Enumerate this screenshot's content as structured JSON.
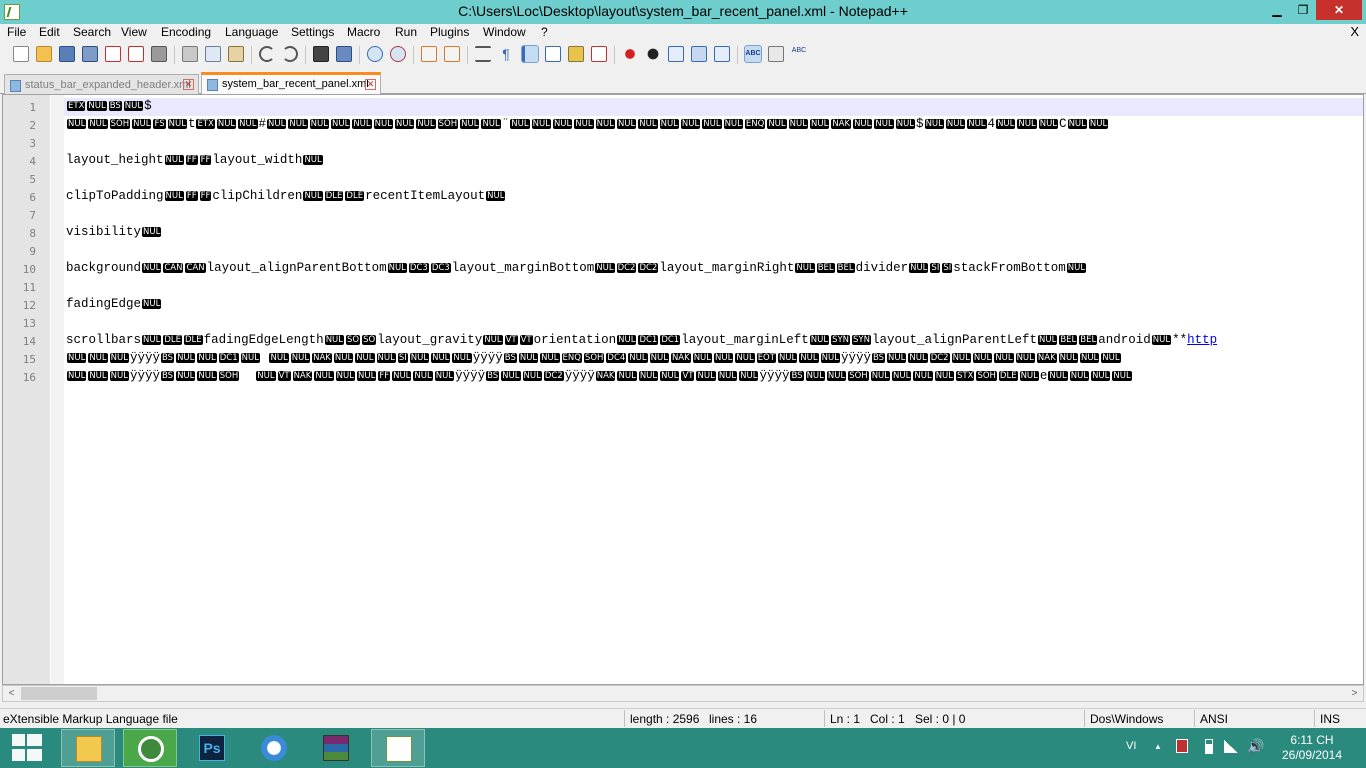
{
  "window": {
    "title": "C:\\Users\\Loc\\Desktop\\layout\\system_bar_recent_panel.xml - Notepad++",
    "min": "▁",
    "max": "❐",
    "close": "✕"
  },
  "menu": {
    "items": [
      "File",
      "Edit",
      "Search",
      "View",
      "Encoding",
      "Language",
      "Settings",
      "Macro",
      "Run",
      "Plugins",
      "Window",
      "?"
    ],
    "close": "X"
  },
  "tabs": [
    {
      "label": "status_bar_expanded_header.xml",
      "close": "✕"
    },
    {
      "label": "system_bar_recent_panel.xml",
      "close": "✕"
    }
  ],
  "editor": {
    "line_numbers": [
      "1",
      "2",
      "3",
      "4",
      "5",
      "6",
      "7",
      "8",
      "9",
      "10",
      "11",
      "12",
      "13",
      "14",
      "15",
      "16"
    ],
    "lines": [
      [
        [
          "c",
          "ETX"
        ],
        [
          "c",
          "NUL"
        ],
        [
          "c",
          "BS"
        ],
        [
          "c",
          "NUL"
        ],
        [
          "t",
          "$"
        ]
      ],
      [
        [
          "c",
          "NUL"
        ],
        [
          "c",
          "NUL"
        ],
        [
          "c",
          "SOH"
        ],
        [
          "c",
          "NUL"
        ],
        [
          "c",
          "FS"
        ],
        [
          "c",
          "NUL"
        ],
        [
          "t",
          "t"
        ],
        [
          "c",
          "ETX"
        ],
        [
          "c",
          "NUL"
        ],
        [
          "c",
          "NUL"
        ],
        [
          "t",
          "#"
        ],
        [
          "c",
          "NUL"
        ],
        [
          "c",
          "NUL"
        ],
        [
          "c",
          "NUL"
        ],
        [
          "c",
          "NUL"
        ],
        [
          "c",
          "NUL"
        ],
        [
          "c",
          "NUL"
        ],
        [
          "c",
          "NUL"
        ],
        [
          "c",
          "NUL"
        ],
        [
          "c",
          "SOH"
        ],
        [
          "c",
          "NUL"
        ],
        [
          "c",
          "NUL"
        ],
        [
          "t",
          "¨"
        ],
        [
          "c",
          "NUL"
        ],
        [
          "c",
          "NUL"
        ],
        [
          "c",
          "NUL"
        ],
        [
          "c",
          "NUL"
        ],
        [
          "c",
          "NUL"
        ],
        [
          "c",
          "NUL"
        ],
        [
          "c",
          "NUL"
        ],
        [
          "c",
          "NUL"
        ],
        [
          "c",
          "NUL"
        ],
        [
          "c",
          "NUL"
        ],
        [
          "c",
          "NUL"
        ],
        [
          "c",
          "ENQ"
        ],
        [
          "c",
          "NUL"
        ],
        [
          "c",
          "NUL"
        ],
        [
          "c",
          "NUL"
        ],
        [
          "c",
          "NAK"
        ],
        [
          "c",
          "NUL"
        ],
        [
          "c",
          "NUL"
        ],
        [
          "c",
          "NUL"
        ],
        [
          "t",
          "$"
        ],
        [
          "c",
          "NUL"
        ],
        [
          "c",
          "NUL"
        ],
        [
          "c",
          "NUL"
        ],
        [
          "t",
          "4"
        ],
        [
          "c",
          "NUL"
        ],
        [
          "c",
          "NUL"
        ],
        [
          "c",
          "NUL"
        ],
        [
          "t",
          "C"
        ],
        [
          "c",
          "NUL"
        ],
        [
          "c",
          "NUL"
        ]
      ],
      [],
      [
        [
          "t",
          "layout_height"
        ],
        [
          "c",
          "NUL"
        ],
        [
          "c",
          "FF"
        ],
        [
          "c",
          "FF"
        ],
        [
          "t",
          "layout_width"
        ],
        [
          "c",
          "NUL"
        ]
      ],
      [],
      [
        [
          "t",
          "clipToPadding"
        ],
        [
          "c",
          "NUL"
        ],
        [
          "c",
          "FF"
        ],
        [
          "c",
          "FF"
        ],
        [
          "t",
          "clipChildren"
        ],
        [
          "c",
          "NUL"
        ],
        [
          "c",
          "DLE"
        ],
        [
          "c",
          "DLE"
        ],
        [
          "t",
          "recentItemLayout"
        ],
        [
          "c",
          "NUL"
        ]
      ],
      [],
      [
        [
          "t",
          "visibility"
        ],
        [
          "c",
          "NUL"
        ]
      ],
      [],
      [
        [
          "t",
          "background"
        ],
        [
          "c",
          "NUL"
        ],
        [
          "c",
          "CAN"
        ],
        [
          "c",
          "CAN"
        ],
        [
          "t",
          "layout_alignParentBottom"
        ],
        [
          "c",
          "NUL"
        ],
        [
          "c",
          "DC3"
        ],
        [
          "c",
          "DC3"
        ],
        [
          "t",
          "layout_marginBottom"
        ],
        [
          "c",
          "NUL"
        ],
        [
          "c",
          "DC2"
        ],
        [
          "c",
          "DC2"
        ],
        [
          "t",
          "layout_marginRight"
        ],
        [
          "c",
          "NUL"
        ],
        [
          "c",
          "BEL"
        ],
        [
          "c",
          "BEL"
        ],
        [
          "t",
          "divider"
        ],
        [
          "c",
          "NUL"
        ],
        [
          "c",
          "SI"
        ],
        [
          "c",
          "SI"
        ],
        [
          "t",
          "stackFromBottom"
        ],
        [
          "c",
          "NUL"
        ]
      ],
      [],
      [
        [
          "t",
          "fadingEdge"
        ],
        [
          "c",
          "NUL"
        ]
      ],
      [],
      [
        [
          "t",
          "scrollbars"
        ],
        [
          "c",
          "NUL"
        ],
        [
          "c",
          "DLE"
        ],
        [
          "c",
          "DLE"
        ],
        [
          "t",
          "fadingEdgeLength"
        ],
        [
          "c",
          "NUL"
        ],
        [
          "c",
          "SO"
        ],
        [
          "c",
          "SO"
        ],
        [
          "t",
          "layout_gravity"
        ],
        [
          "c",
          "NUL"
        ],
        [
          "c",
          "VT"
        ],
        [
          "c",
          "VT"
        ],
        [
          "t",
          "orientation"
        ],
        [
          "c",
          "NUL"
        ],
        [
          "c",
          "DC1"
        ],
        [
          "c",
          "DC1"
        ],
        [
          "t",
          "layout_marginLeft"
        ],
        [
          "c",
          "NUL"
        ],
        [
          "c",
          "SYN"
        ],
        [
          "c",
          "SYN"
        ],
        [
          "t",
          "layout_alignParentLeft"
        ],
        [
          "c",
          "NUL"
        ],
        [
          "c",
          "BEL"
        ],
        [
          "c",
          "BEL"
        ],
        [
          "t",
          "android"
        ],
        [
          "c",
          "NUL"
        ],
        [
          "t",
          "**"
        ],
        [
          "l",
          "http"
        ]
      ],
      [
        [
          "c",
          "NUL"
        ],
        [
          "c",
          "NUL"
        ],
        [
          "c",
          "NUL"
        ],
        [
          "t",
          "ÿÿÿÿ"
        ],
        [
          "c",
          "BS"
        ],
        [
          "c",
          "NUL"
        ],
        [
          "c",
          "NUL"
        ],
        [
          "c",
          "DC1"
        ],
        [
          "c",
          "NUL"
        ],
        [
          "t",
          " "
        ],
        [
          "c",
          "NUL"
        ],
        [
          "c",
          "NUL"
        ],
        [
          "c",
          "NAK"
        ],
        [
          "c",
          "NUL"
        ],
        [
          "c",
          "NUL"
        ],
        [
          "c",
          "NUL"
        ],
        [
          "c",
          "SI"
        ],
        [
          "c",
          "NUL"
        ],
        [
          "c",
          "NUL"
        ],
        [
          "c",
          "NUL"
        ],
        [
          "t",
          "ÿÿÿÿ"
        ],
        [
          "c",
          "BS"
        ],
        [
          "c",
          "NUL"
        ],
        [
          "c",
          "NUL"
        ],
        [
          "c",
          "ENQ"
        ],
        [
          "c",
          "SOH"
        ],
        [
          "c",
          "DC4"
        ],
        [
          "c",
          "NUL"
        ],
        [
          "c",
          "NUL"
        ],
        [
          "c",
          "NAK"
        ],
        [
          "c",
          "NUL"
        ],
        [
          "c",
          "NUL"
        ],
        [
          "c",
          "NUL"
        ],
        [
          "c",
          "EOT"
        ],
        [
          "c",
          "NUL"
        ],
        [
          "c",
          "NUL"
        ],
        [
          "c",
          "NUL"
        ],
        [
          "t",
          "ÿÿÿÿ"
        ],
        [
          "c",
          "BS"
        ],
        [
          "c",
          "NUL"
        ],
        [
          "c",
          "NUL"
        ],
        [
          "c",
          "DC2"
        ],
        [
          "c",
          "NUL"
        ],
        [
          "c",
          "NUL"
        ],
        [
          "c",
          "NUL"
        ],
        [
          "c",
          "NUL"
        ],
        [
          "c",
          "NAK"
        ],
        [
          "c",
          "NUL"
        ],
        [
          "c",
          "NUL"
        ],
        [
          "c",
          "NUL"
        ]
      ],
      [
        [
          "c",
          "NUL"
        ],
        [
          "c",
          "NUL"
        ],
        [
          "c",
          "NUL"
        ],
        [
          "t",
          "ÿÿÿÿ"
        ],
        [
          "c",
          "BS"
        ],
        [
          "c",
          "NUL"
        ],
        [
          "c",
          "NUL"
        ],
        [
          "c",
          "SOH"
        ],
        [
          "t",
          "  "
        ],
        [
          "c",
          "NUL"
        ],
        [
          "c",
          "VT"
        ],
        [
          "c",
          "NAK"
        ],
        [
          "c",
          "NUL"
        ],
        [
          "c",
          "NUL"
        ],
        [
          "c",
          "NUL"
        ],
        [
          "c",
          "FF"
        ],
        [
          "c",
          "NUL"
        ],
        [
          "c",
          "NUL"
        ],
        [
          "c",
          "NUL"
        ],
        [
          "t",
          "ÿÿÿÿ"
        ],
        [
          "c",
          "BS"
        ],
        [
          "c",
          "NUL"
        ],
        [
          "c",
          "NUL"
        ],
        [
          "c",
          "DC2"
        ],
        [
          "t",
          "ÿÿÿÿ"
        ],
        [
          "c",
          "NAK"
        ],
        [
          "c",
          "NUL"
        ],
        [
          "c",
          "NUL"
        ],
        [
          "c",
          "NUL"
        ],
        [
          "c",
          "VT"
        ],
        [
          "c",
          "NUL"
        ],
        [
          "c",
          "NUL"
        ],
        [
          "c",
          "NUL"
        ],
        [
          "t",
          "ÿÿÿÿ"
        ],
        [
          "c",
          "BS"
        ],
        [
          "c",
          "NUL"
        ],
        [
          "c",
          "NUL"
        ],
        [
          "c",
          "SOH"
        ],
        [
          "c",
          "NUL"
        ],
        [
          "c",
          "NUL"
        ],
        [
          "c",
          "NUL"
        ],
        [
          "c",
          "NUL"
        ],
        [
          "c",
          "STX"
        ],
        [
          "c",
          "SOH"
        ],
        [
          "c",
          "DLE"
        ],
        [
          "c",
          "NUL"
        ],
        [
          "t",
          "e"
        ],
        [
          "c",
          "NUL"
        ],
        [
          "c",
          "NUL"
        ],
        [
          "c",
          "NUL"
        ],
        [
          "c",
          "NUL"
        ]
      ]
    ]
  },
  "hscroll": {
    "left": "<",
    "right": ">"
  },
  "status": {
    "file_type": "eXtensible Markup Language file",
    "length": "length : 2596",
    "lines": "lines : 16",
    "ln": "Ln : 1",
    "col": "Col : 1",
    "sel": "Sel : 0 | 0",
    "eol": "Dos\\Windows",
    "encoding": "ANSI",
    "mode": "INS"
  },
  "taskbar": {
    "lang": "VI",
    "time": "6:11 CH",
    "date": "26/09/2014"
  },
  "colors": {
    "titlebar": "#6ecdcd",
    "taskbar": "#2a8a7e",
    "close": "#c7312c",
    "active_tab": "#fa8c1e",
    "current_line": "#e8e8ff"
  }
}
